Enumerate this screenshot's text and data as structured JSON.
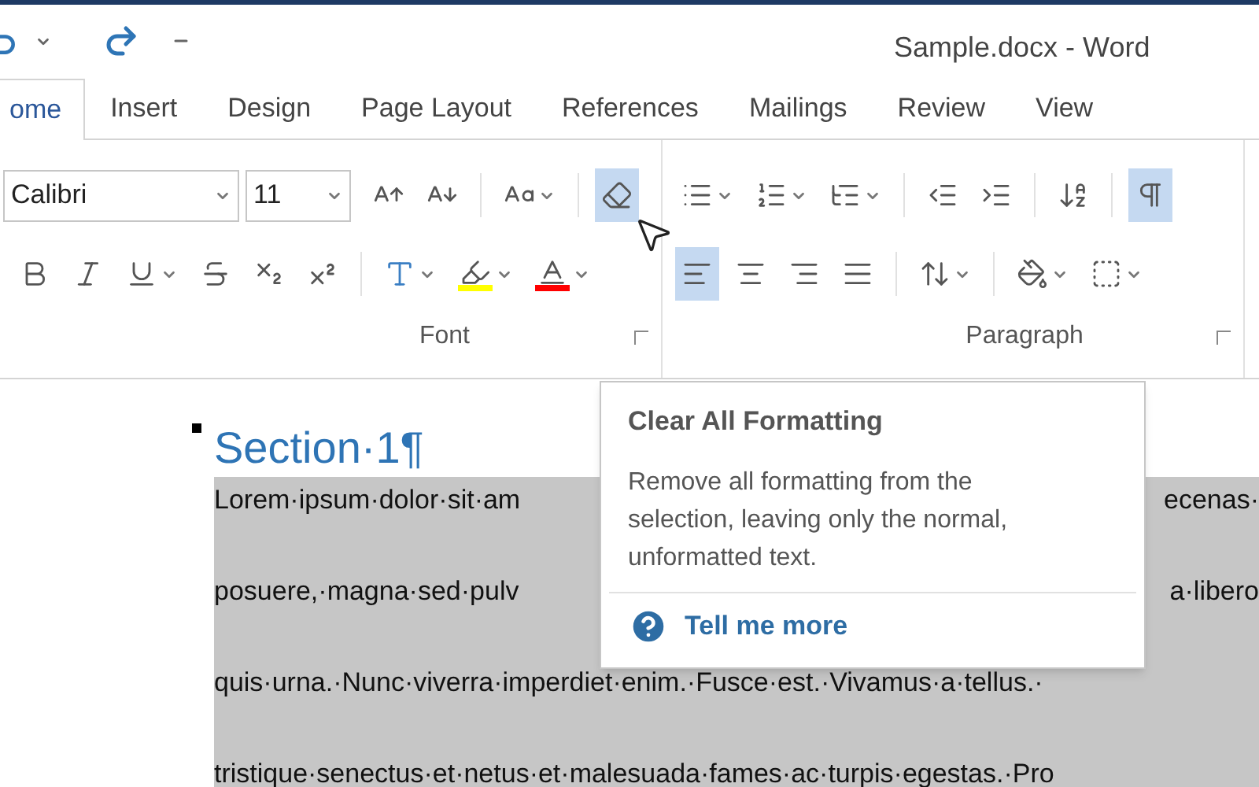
{
  "title_bar": {
    "title": "Sample.docx - Word"
  },
  "tabs": [
    {
      "label": "ome",
      "selected": true
    },
    {
      "label": "Insert",
      "selected": false
    },
    {
      "label": "Design",
      "selected": false
    },
    {
      "label": "Page Layout",
      "selected": false
    },
    {
      "label": "References",
      "selected": false
    },
    {
      "label": "Mailings",
      "selected": false
    },
    {
      "label": "Review",
      "selected": false
    },
    {
      "label": "View",
      "selected": false
    }
  ],
  "font_group": {
    "label": "Font",
    "font_name": "Calibri",
    "font_size": "11",
    "row1": [
      {
        "kind": "grow",
        "selected": false,
        "dropdown": false
      },
      {
        "kind": "shrink",
        "selected": false,
        "dropdown": false
      },
      {
        "kind": "divider"
      },
      {
        "kind": "case",
        "selected": false,
        "dropdown": true
      },
      {
        "kind": "divider"
      },
      {
        "kind": "clear",
        "selected": true,
        "dropdown": false
      }
    ],
    "row2": [
      {
        "kind": "bold",
        "selected": false,
        "dropdown": false
      },
      {
        "kind": "italic",
        "selected": false,
        "dropdown": false
      },
      {
        "kind": "underline",
        "selected": false,
        "dropdown": true
      },
      {
        "kind": "strike",
        "selected": false,
        "dropdown": false
      },
      {
        "kind": "subscript",
        "selected": false,
        "dropdown": false
      },
      {
        "kind": "superscript",
        "selected": false,
        "dropdown": false
      },
      {
        "kind": "divider"
      },
      {
        "kind": "effects",
        "selected": false,
        "dropdown": true
      },
      {
        "kind": "highlight",
        "selected": false,
        "dropdown": true,
        "color": "#ffff00"
      },
      {
        "kind": "fontcolor",
        "selected": false,
        "dropdown": true,
        "color": "#ff0000"
      }
    ]
  },
  "paragraph_group": {
    "label": "Paragraph",
    "row1": [
      {
        "kind": "bullets",
        "selected": false,
        "dropdown": true
      },
      {
        "kind": "numbering",
        "selected": false,
        "dropdown": true
      },
      {
        "kind": "multilevel",
        "selected": false,
        "dropdown": true
      },
      {
        "kind": "divider"
      },
      {
        "kind": "outdent",
        "selected": false,
        "dropdown": false
      },
      {
        "kind": "indent",
        "selected": false,
        "dropdown": false
      },
      {
        "kind": "divider"
      },
      {
        "kind": "sort",
        "selected": false,
        "dropdown": false
      },
      {
        "kind": "divider"
      },
      {
        "kind": "marks",
        "selected": true,
        "dropdown": false
      }
    ],
    "row2": [
      {
        "kind": "left",
        "selected": true,
        "dropdown": false
      },
      {
        "kind": "center",
        "selected": false,
        "dropdown": false
      },
      {
        "kind": "right",
        "selected": false,
        "dropdown": false
      },
      {
        "kind": "justify",
        "selected": false,
        "dropdown": false
      },
      {
        "kind": "divider"
      },
      {
        "kind": "spacing",
        "selected": false,
        "dropdown": true
      },
      {
        "kind": "divider"
      },
      {
        "kind": "shading",
        "selected": false,
        "dropdown": true
      },
      {
        "kind": "borders",
        "selected": false,
        "dropdown": true
      }
    ]
  },
  "document": {
    "heading": "Section·1¶",
    "lines": [
      {
        "left": "Lorem·ipsum·dolor·sit·am",
        "right": "ecenas·"
      },
      {
        "left": "posuere,·magna·sed·pulv",
        "right": "a·libero"
      },
      {
        "left": "quis·urna.·Nunc·viverra·imperdiet·enim.·Fusce·est.·Vivamus·a·tellus.·"
      },
      {
        "left": "tristique·senectus·et·netus·et·malesuada·fames·ac·turpis·egestas.·Pro"
      }
    ]
  },
  "tooltip": {
    "title": "Clear All Formatting",
    "body": "Remove all formatting from the selection, leaving only the normal, unformatted text.",
    "link": "Tell me more"
  }
}
